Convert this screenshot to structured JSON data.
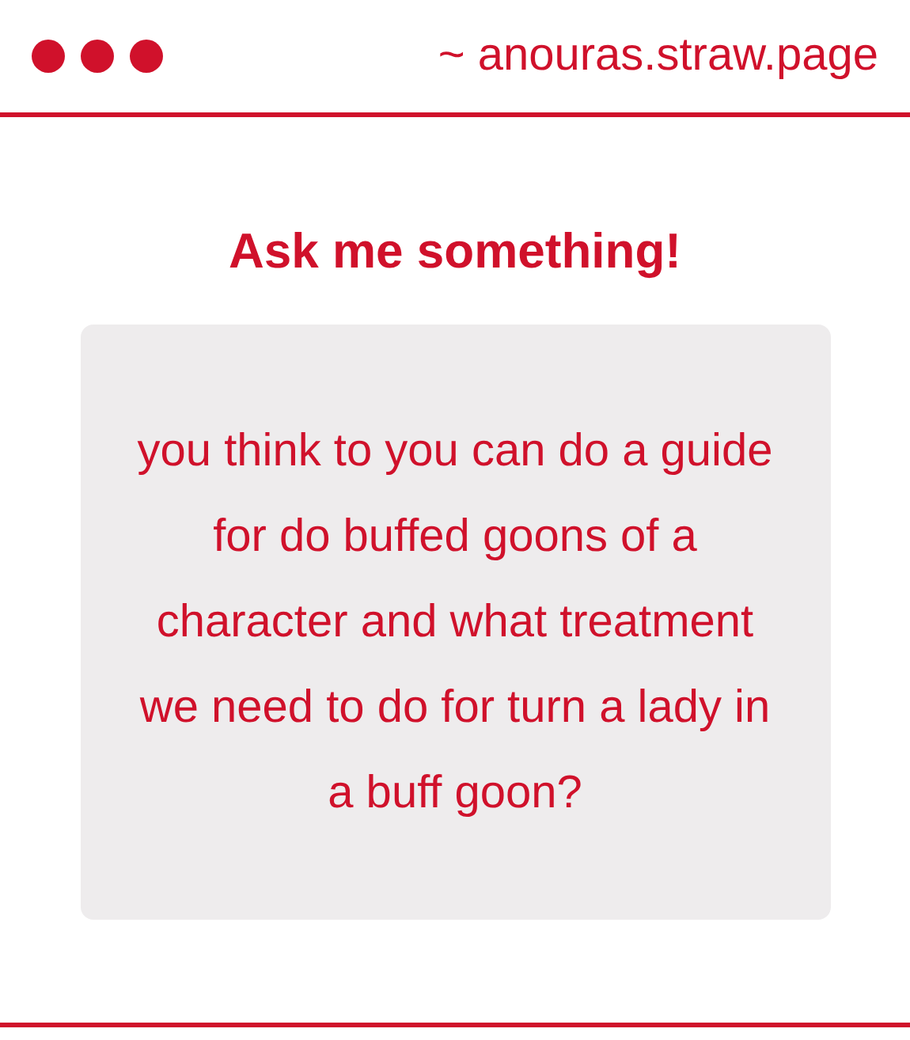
{
  "window": {
    "url": "~ anouras.straw.page"
  },
  "title": "Ask me something!",
  "question": "you think to you can do a guide for do buffed goons of a character and what treatment we need to do for turn a lady in a buff goon?"
}
